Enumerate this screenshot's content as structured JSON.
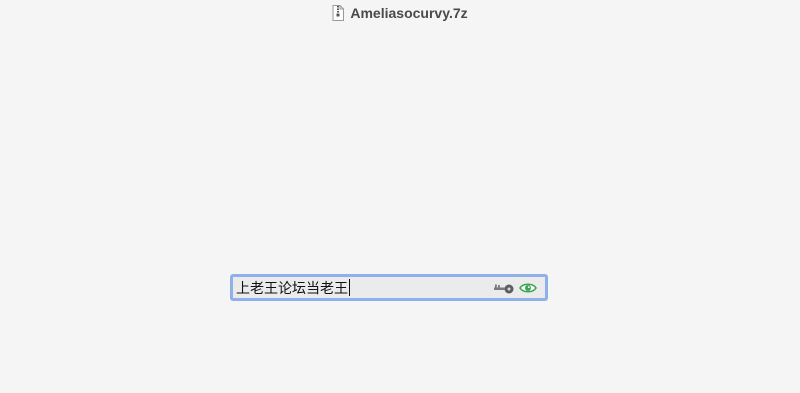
{
  "window": {
    "title": "Ameliasocurvy.7z",
    "file_icon": "archive-file-icon"
  },
  "password": {
    "value": "上老王论坛当老王",
    "key_icon": "key-icon",
    "reveal_icon": "eye-icon",
    "focus_color": "#8fb0ea",
    "reveal_color": "#3aa655"
  }
}
